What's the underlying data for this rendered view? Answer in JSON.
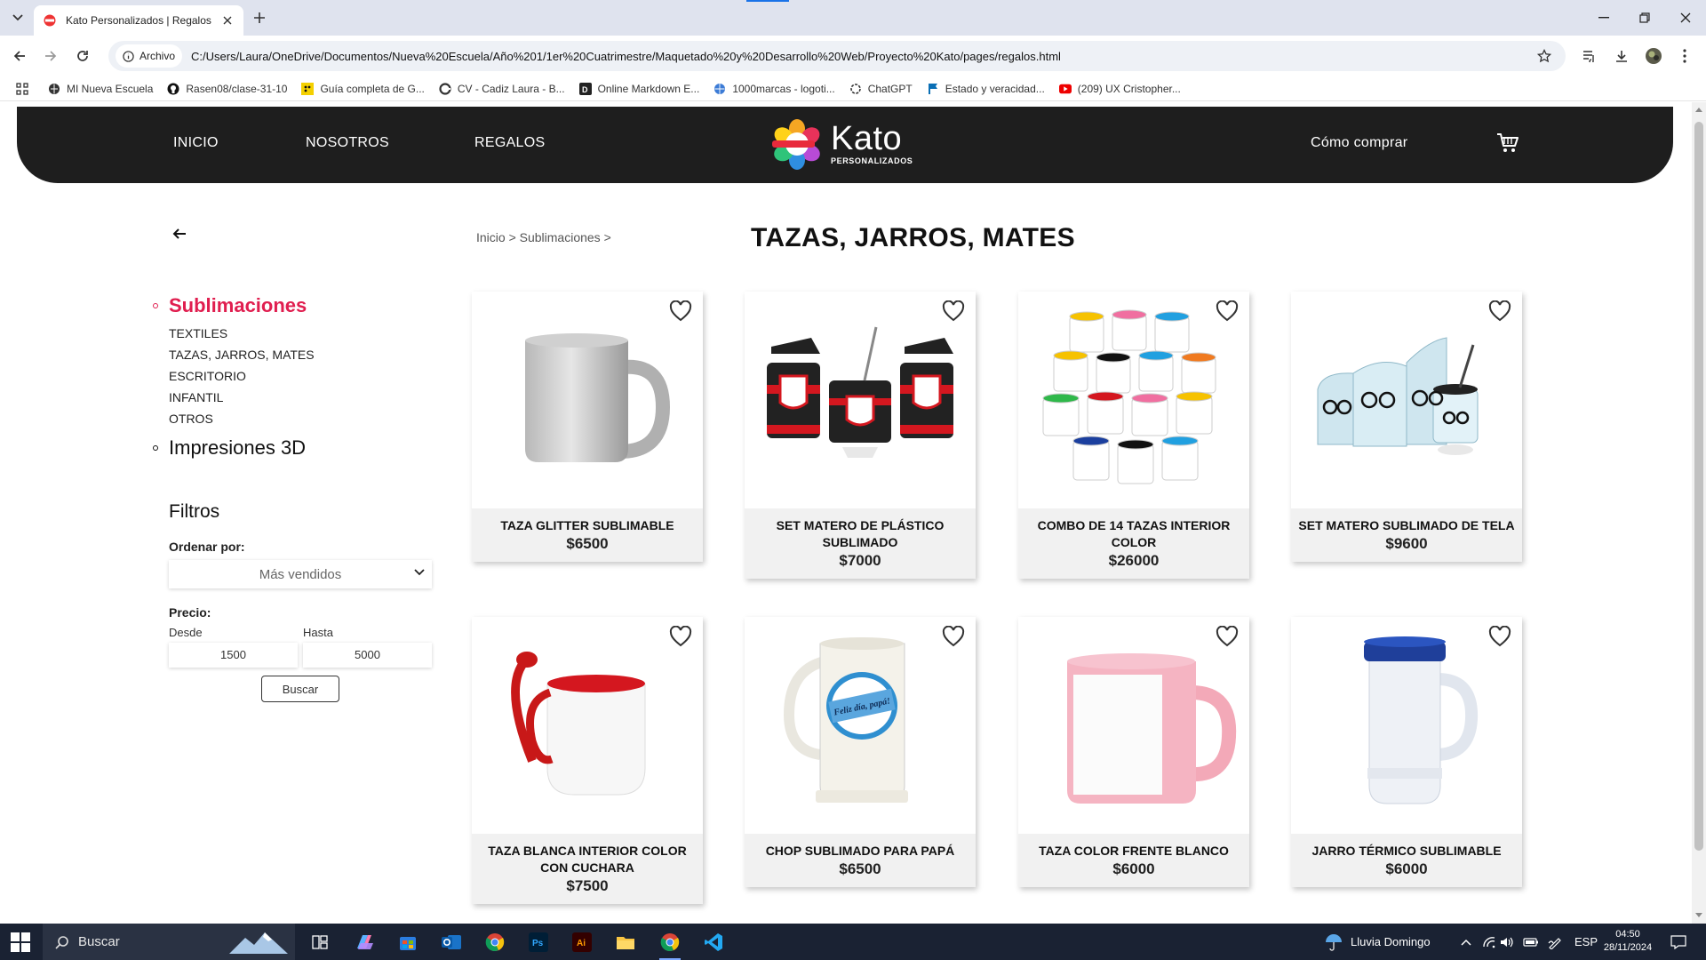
{
  "browser": {
    "tab_title": "Kato Personalizados | Regalos",
    "site_chip": "Archivo",
    "url": "C:/Users/Laura/OneDrive/Documentos/Nueva%20Escuela/Año%201/1er%20Cuatrimestre/Maquetado%20y%20Desarrollo%20Web/Proyecto%20Kato/pages/regalos.html",
    "bookmarks": [
      {
        "label": "MI Nueva Escuela",
        "icon": "globe-icon"
      },
      {
        "label": "Rasen08/clase-31-10",
        "icon": "github-icon"
      },
      {
        "label": "Guía completa de G...",
        "icon": "guide-icon"
      },
      {
        "label": "CV - Cadiz Laura - B...",
        "icon": "cv-icon"
      },
      {
        "label": "Online Markdown E...",
        "icon": "markdown-icon"
      },
      {
        "label": "1000marcas - logoti...",
        "icon": "globe-icon"
      },
      {
        "label": "ChatGPT",
        "icon": "chatgpt-icon"
      },
      {
        "label": "Estado y veracidad...",
        "icon": "flag-icon"
      },
      {
        "label": "(209) UX Cristopher...",
        "icon": "youtube-icon"
      }
    ]
  },
  "site": {
    "nav": {
      "inicio": "INICIO",
      "nosotros": "NOSOTROS",
      "regalos": "REGALOS",
      "como_comprar": "Cómo comprar"
    },
    "logo": {
      "name": "Kato",
      "sub": "PERSONALIZADOS"
    },
    "breadcrumb": "Inicio > Sublimaciones >",
    "title": "TAZAS, JARROS, MATES",
    "sidebar": {
      "active_category": "Sublimaciones",
      "subcategories": [
        "TEXTILES",
        "TAZAS, JARROS, MATES",
        "ESCRITORIO",
        "INFANTIL",
        "OTROS"
      ],
      "second_category": "Impresiones 3D"
    },
    "filters": {
      "title": "Filtros",
      "order_label": "Ordenar por:",
      "order_value": "Más vendidos",
      "price_label": "Precio:",
      "from_label": "Desde",
      "to_label": "Hasta",
      "from_value": "1500",
      "to_value": "5000",
      "search_button": "Buscar"
    },
    "products": [
      {
        "name": "TAZA GLITTER SUBLIMABLE",
        "price": "$6500"
      },
      {
        "name": "SET MATERO DE PLÁSTICO SUBLIMADO",
        "price": "$7000"
      },
      {
        "name": "COMBO DE 14 TAZAS INTERIOR COLOR",
        "price": "$26000"
      },
      {
        "name": "SET MATERO SUBLIMADO DE TELA",
        "price": "$9600"
      },
      {
        "name": "TAZA BLANCA INTERIOR COLOR CON CUCHARA",
        "price": "$7500"
      },
      {
        "name": "CHOP SUBLIMADO PARA PAPÁ",
        "price": "$6500"
      },
      {
        "name": "TAZA COLOR FRENTE BLANCO",
        "price": "$6000"
      },
      {
        "name": "JARRO TÉRMICO SUBLIMABLE",
        "price": "$6000"
      }
    ],
    "chop_print": "Feliz día, papá!"
  },
  "taskbar": {
    "search_placeholder": "Buscar",
    "weather": "Lluvia Domingo",
    "lang": "ESP",
    "time": "04:50",
    "date": "28/11/2024"
  },
  "colors": {
    "accent": "#e01e4f",
    "nav_bg": "#1e1e1e",
    "card_info_bg": "#f1f1f1"
  }
}
